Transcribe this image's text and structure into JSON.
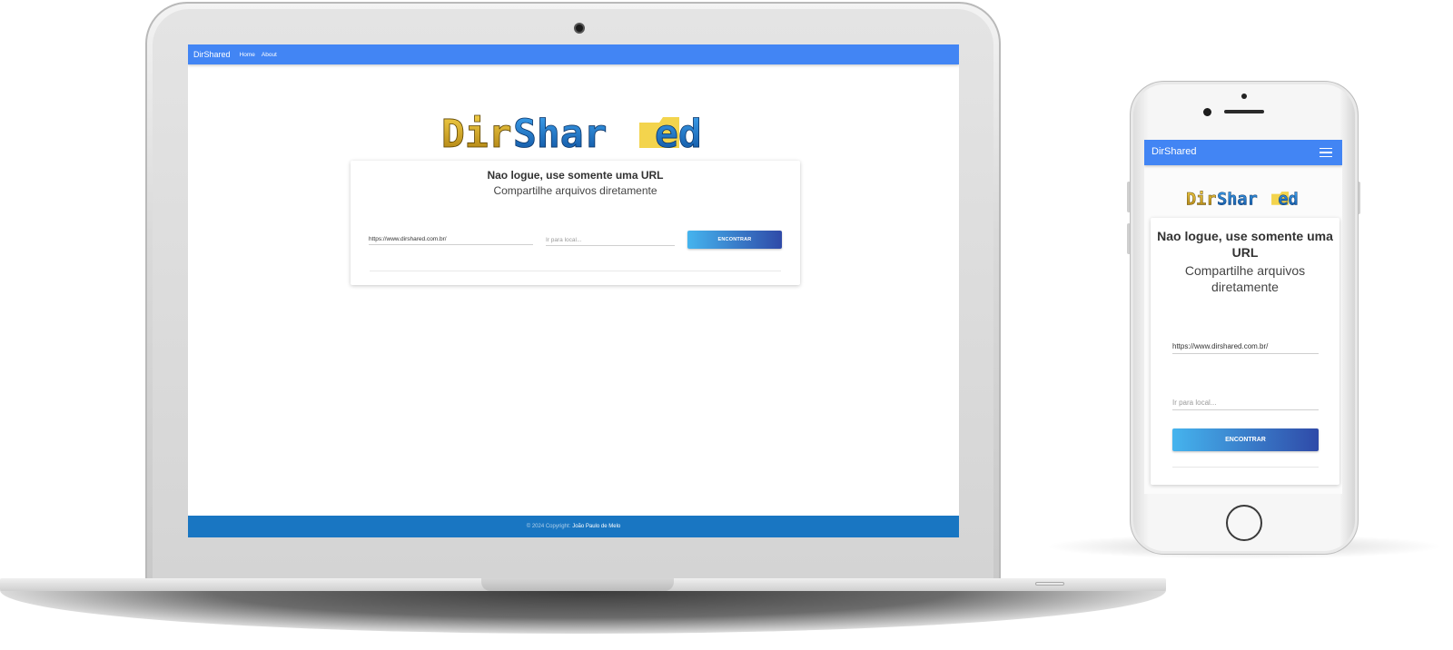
{
  "app": {
    "brand": "DirShared"
  },
  "nav": {
    "links": [
      "Home",
      "About"
    ]
  },
  "logo": {
    "part1": "Dir",
    "part2": "Shar",
    "part3": "ed"
  },
  "hero": {
    "title": "Nao logue, use somente uma URL",
    "subtitle": "Compartilhe arquivos diretamente"
  },
  "form": {
    "url_value": "https://www.dirshared.com.br/",
    "location_placeholder": "Ir para local...",
    "submit_label": "ENCONTRAR"
  },
  "footer": {
    "copyright": "© 2024 Copyright:",
    "author": "João Paulo de Melo"
  },
  "colors": {
    "navbar": "#4285f4",
    "footer": "#1976c2",
    "button_start": "#45b4ee",
    "button_end": "#2f4aa8",
    "logo_gold": "#e0b21f",
    "logo_blue": "#1c73c7"
  },
  "icons": {
    "mobile_menu": "hamburger-menu-icon"
  }
}
